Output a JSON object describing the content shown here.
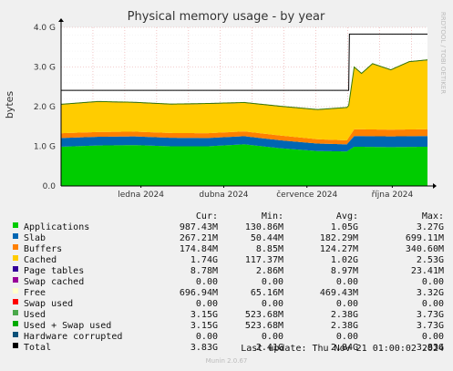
{
  "chart_data": {
    "type": "area",
    "title": "Physical memory usage - by year",
    "ylabel": "bytes",
    "ylim": [
      0,
      4
    ],
    "y_unit": "G",
    "y_ticks": [
      "0.0",
      "1.0 G",
      "2.0 G",
      "3.0 G",
      "4.0 G"
    ],
    "x_ticks": [
      "ledna 2024",
      "dubna 2024",
      "července 2024",
      "října 2024"
    ],
    "side_label": "RRDTOOL / TOBI OETIKER",
    "stacked_series": [
      {
        "name": "Applications",
        "color": "#00cc00",
        "x": [
          0,
          0.1,
          0.2,
          0.3,
          0.4,
          0.5,
          0.6,
          0.7,
          0.78,
          0.8,
          0.9,
          1.0
        ],
        "values": [
          0.99,
          1.02,
          1.03,
          1.0,
          1.0,
          1.05,
          0.95,
          0.88,
          0.87,
          0.99,
          0.98,
          0.99
        ]
      },
      {
        "name": "Slab",
        "color": "#0066b3",
        "x": [
          0,
          0.2,
          0.4,
          0.6,
          0.78,
          0.8,
          1.0
        ],
        "values": [
          0.22,
          0.22,
          0.21,
          0.2,
          0.18,
          0.27,
          0.27
        ]
      },
      {
        "name": "Buffers",
        "color": "#ff8000",
        "x": [
          0,
          0.2,
          0.4,
          0.6,
          0.78,
          0.8,
          1.0
        ],
        "values": [
          0.12,
          0.12,
          0.12,
          0.12,
          0.1,
          0.17,
          0.17
        ]
      },
      {
        "name": "Cached",
        "color": "#ffcc00",
        "x": [
          0,
          0.1,
          0.2,
          0.3,
          0.4,
          0.5,
          0.6,
          0.7,
          0.78,
          0.785,
          0.8,
          0.82,
          0.85,
          0.9,
          0.95,
          1.0
        ],
        "values": [
          0.72,
          0.76,
          0.73,
          0.72,
          0.74,
          0.72,
          0.73,
          0.74,
          0.82,
          0.8,
          1.56,
          1.4,
          1.65,
          1.5,
          1.7,
          1.74
        ]
      },
      {
        "name": "Page tables",
        "color": "#330099",
        "x": [
          0,
          1.0
        ],
        "values": [
          0.01,
          0.01
        ]
      }
    ],
    "total_series": {
      "name": "Total",
      "color": "#000000",
      "x": [
        0,
        0.785,
        0.787,
        1.0
      ],
      "values": [
        2.41,
        2.41,
        3.83,
        3.83
      ]
    },
    "columns": [
      "Cur:",
      "Min:",
      "Avg:",
      "Max:"
    ],
    "legend": [
      {
        "name": "Applications",
        "color": "#00cc00",
        "cur": "987.43M",
        "min": "130.86M",
        "avg": "1.05G",
        "max": "3.27G"
      },
      {
        "name": "Slab",
        "color": "#0066b3",
        "cur": "267.21M",
        "min": "50.44M",
        "avg": "182.29M",
        "max": "699.11M"
      },
      {
        "name": "Buffers",
        "color": "#ff8000",
        "cur": "174.84M",
        "min": "8.85M",
        "avg": "124.27M",
        "max": "340.60M"
      },
      {
        "name": "Cached",
        "color": "#ffcc00",
        "cur": "1.74G",
        "min": "117.37M",
        "avg": "1.02G",
        "max": "2.53G"
      },
      {
        "name": "Page tables",
        "color": "#330099",
        "cur": "8.78M",
        "min": "2.86M",
        "avg": "8.97M",
        "max": "23.41M"
      },
      {
        "name": "Swap cached",
        "color": "#990099",
        "cur": "0.00",
        "min": "0.00",
        "avg": "0.00",
        "max": "0.00"
      },
      {
        "name": "Free",
        "color": "#ffffcc",
        "cur": "696.94M",
        "min": "65.16M",
        "avg": "469.43M",
        "max": "3.32G"
      },
      {
        "name": "Swap used",
        "color": "#ff0000",
        "cur": "0.00",
        "min": "0.00",
        "avg": "0.00",
        "max": "0.00"
      },
      {
        "name": "Used",
        "color": "#4aa84a",
        "cur": "3.15G",
        "min": "523.68M",
        "avg": "2.38G",
        "max": "3.73G"
      },
      {
        "name": "Used + Swap used",
        "color": "#00aa00",
        "cur": "3.15G",
        "min": "523.68M",
        "avg": "2.38G",
        "max": "3.73G"
      },
      {
        "name": "Hardware corrupted",
        "color": "#0a5078",
        "cur": "0.00",
        "min": "0.00",
        "avg": "0.00",
        "max": "0.00"
      },
      {
        "name": "Total",
        "color": "#000000",
        "cur": "3.83G",
        "min": "2.41G",
        "avg": "2.84G",
        "max": "3.83G"
      }
    ]
  },
  "footer": {
    "last_update": "Last update: Thu Nov 21 01:00:02 2024",
    "munin_version": "Munin 2.0.67"
  }
}
